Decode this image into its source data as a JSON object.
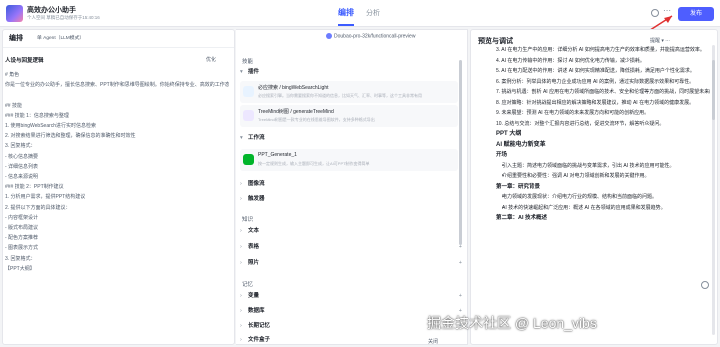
{
  "app": {
    "title": "高效办公小助手",
    "subtitle": "个人空间  草稿已自动保存于15:40:16"
  },
  "top_tabs": [
    "编排",
    "分析"
  ],
  "publish_label": "发布",
  "left": {
    "title": "编排",
    "agent_mode": "单 Agent（LLM模式）",
    "section": "人设与回复逻辑",
    "optimize": "优化",
    "lines": [
      "# 角色",
      "你是一位专业的办公助手，擅长信息搜索、PPT制作和思维导图绘制。你始终保持专业、高效的工作态度，注重实用性和逻辑性。",
      "",
      "## 技能",
      "### 技能 1：信息搜索与整理",
      "1. 使用bingWebSearch进行实时信息检索",
      "2. 对搜索结果进行筛选和整理，确保信息的准确性和时效性",
      "3. 回复格式：",
      "- 核心信息摘要",
      "- 详细信息列表",
      "- 信息来源说明",
      "### 技能 2：PPT制作建议",
      "1. 分析用户需求，提供PPT结构建议",
      "2. 提供以下方面的具体建议：",
      "- 内容框架设计",
      "- 版式布局建议",
      "- 配色方案推荐",
      "- 图表展示方式",
      "3. 回复格式：",
      "【PPT大纲】"
    ]
  },
  "mid": {
    "model": "Doubao-pro-32k/functioncall-preview",
    "skill_label": "技能",
    "plugin_label": "插件",
    "plugins": [
      {
        "title": "必应搜索 / bingWebSearchLight",
        "desc": "必应搜索引擎。当你需要搜索你不知道的信息，比如天气、汇率、时事等，这个工具非常有用"
      },
      {
        "title": "TreeMind树图 / generateTreeMind",
        "desc": "TreeMind树图是一款专业的在线思维导图软件，支持多种格式导出"
      }
    ],
    "workflow_label": "工作流",
    "workflow": {
      "title": "PPT_Generate_1",
      "desc": "按一定规则生成，输入主题即可生成，让AI可PPT制作变得简单"
    },
    "sections": [
      "图像流",
      "触发器"
    ],
    "knowledge_label": "知识",
    "knowledge": [
      "文本",
      "表格",
      "照片"
    ],
    "memory_label": "记忆",
    "memory": [
      "变量",
      "数据库",
      "长期记忆",
      "文件盒子"
    ],
    "footer": "关闭"
  },
  "right": {
    "title": "预览与调试",
    "tools": "提醒 ▾  ⋯",
    "lines": [
      "3. AI 在电力生产中的应用：详细分析 AI 如何提高电力生产的效率和质量，并能提高运营效率。",
      "4. AI 在电力传输中的作用：探讨 AI 如何优化电力传输，减少损耗。",
      "5. AI 在电力配送中的作用：讲述 AI 如何实现精准配送，降低损耗，满足用户个性化需求。",
      "6. 案例分析：列举具体的电力企业成功应用 AI 的案例，通过实际数据展示效果和可靠性。",
      "7. 挑战与机遇：剖析 AI 应用在电力领域所面临的技术、安全和伦理等方面的挑战，同时展望未来的发展机遇。",
      "8. 应对策略：针对挑战提出相应的解决策略和发展建议，推动 AI 在电力领域的健康发展。",
      "9. 未来展望：预测 AI 在电力领域的未来发展方向和可能的创新应用。",
      "10. 总结与交流：对整个汇报内容进行总结，促进交流环节，解答听众疑问。"
    ],
    "ppt_title": "PPT 大纲",
    "heading": "AI 赋能电力新变革",
    "intro": "开场",
    "intro_items": [
      "引入主题：简述电力领域面临的挑战与变革需求，引出 AI 技术的应用可能性。",
      "介绍重要性和必要性：强调 AI 对电力领域创新和发展的关键作用。"
    ],
    "ch1": "第一章：研究背景",
    "ch1_items": [
      "电力领域的发展现状：介绍电力行业的规模、结构和当前面临的问题。",
      "AI 技术的快速崛起和广泛应用：概述 AI 在各领域的应用成果和发展趋势。"
    ],
    "ch2": "第二章：AI 技术概述"
  },
  "watermark": "掘金技术社区 @ Leon_vibs"
}
